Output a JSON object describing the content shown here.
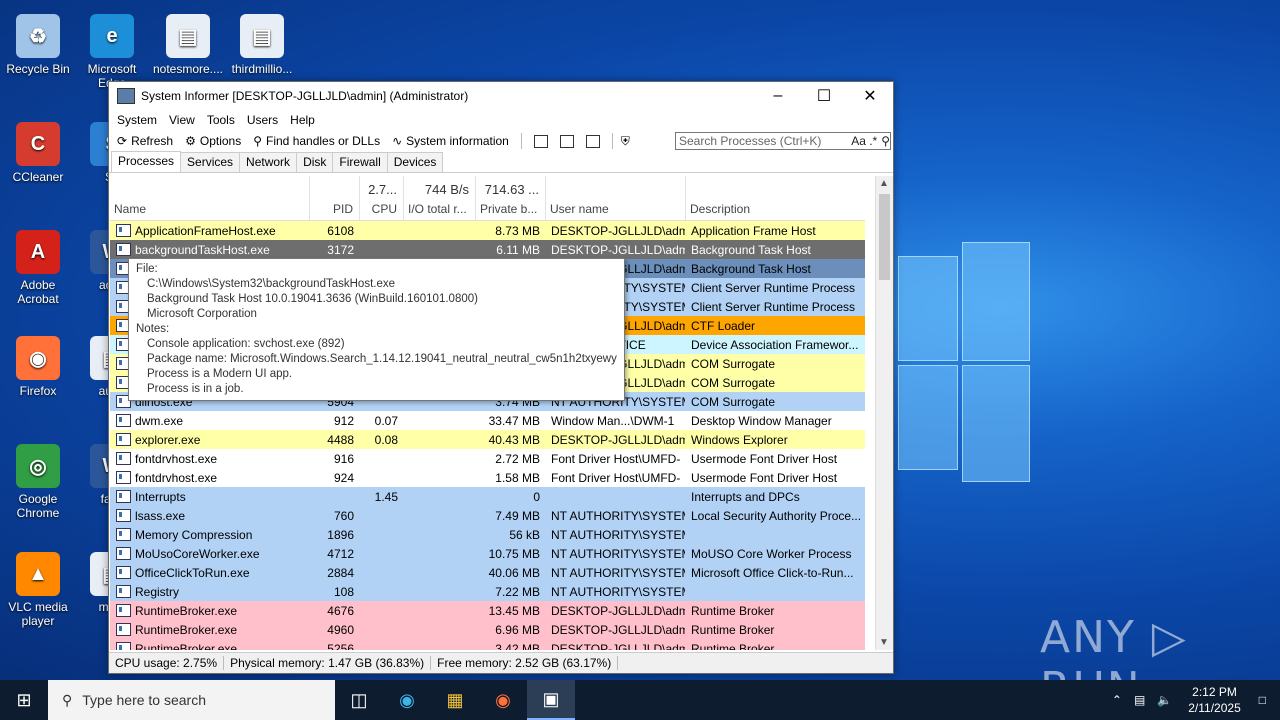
{
  "desktop": {
    "icons": [
      {
        "label": "Recycle Bin",
        "color": "#9fc4e8",
        "glyph": "♻"
      },
      {
        "label": "Microsoft Edge",
        "color": "#1d8fd8",
        "glyph": "e"
      },
      {
        "label": "notesmore....",
        "color": "#e8eef5",
        "glyph": "▤"
      },
      {
        "label": "thirdmillio...",
        "color": "#e8eef5",
        "glyph": "▤"
      },
      {
        "label": "CCleaner",
        "color": "#d63b2f",
        "glyph": "C"
      },
      {
        "label": "Sk",
        "color": "#2d7fd3",
        "glyph": "S"
      },
      {
        "label": "Adobe Acrobat",
        "color": "#d4221a",
        "glyph": "A"
      },
      {
        "label": "acad",
        "color": "#2b579a",
        "glyph": "W"
      },
      {
        "label": "Firefox",
        "color": "#ff7139",
        "glyph": "◉"
      },
      {
        "label": "augu",
        "color": "#e8eef5",
        "glyph": "▤"
      },
      {
        "label": "Google Chrome",
        "color": "#2f9e44",
        "glyph": "◎"
      },
      {
        "label": "fami",
        "color": "#2b579a",
        "glyph": "W"
      },
      {
        "label": "VLC media player",
        "color": "#ff8800",
        "glyph": "▲"
      },
      {
        "label": "moth",
        "color": "#e8eef5",
        "glyph": "▤"
      }
    ],
    "watermark": "ANY ▷ RUN"
  },
  "window": {
    "title": "System Informer [DESKTOP-JGLLJLD\\admin] (Administrator)",
    "menu": [
      "System",
      "View",
      "Tools",
      "Users",
      "Help"
    ],
    "toolbar": {
      "refresh": "Refresh",
      "options": "Options",
      "find": "Find handles or DLLs",
      "sysinfo": "System information"
    },
    "search_placeholder": "Search Processes (Ctrl+K)",
    "search_suffix": "Aa .*",
    "tabs": [
      "Processes",
      "Services",
      "Network",
      "Disk",
      "Firewall",
      "Devices"
    ],
    "header": {
      "name": "Name",
      "pid": "PID",
      "cpu": "CPU",
      "cpu_total": "2.7...",
      "io": "I/O total r...",
      "io_total": "744 B/s",
      "private": "Private b...",
      "private_total": "714.63 ...",
      "user": "User name",
      "desc": "Description"
    },
    "rows": [
      {
        "name": "ApplicationFrameHost.exe",
        "pid": "6108",
        "cpu": "",
        "io": "",
        "priv": "8.73 MB",
        "user": "DESKTOP-JGLLJLD\\admi",
        "desc": "Application Frame Host",
        "bg": "#ffffa8"
      },
      {
        "name": "backgroundTaskHost.exe",
        "pid": "3172",
        "cpu": "",
        "io": "",
        "priv": "6.11 MB",
        "user": "DESKTOP-JGLLJLD\\admi",
        "desc": "Background Task Host",
        "bg": "#6e6e6e"
      },
      {
        "name": "",
        "pid": "",
        "cpu": "",
        "io": "",
        "priv": "",
        "user": "DESKTOP-JGLLJLD\\admi",
        "desc": "Background Task Host",
        "bg": "#6b8fba"
      },
      {
        "name": "",
        "pid": "",
        "cpu": "",
        "io": "",
        "priv": "",
        "user": "NT AUTHORITY\\SYSTEM",
        "desc": "Client Server Runtime Process",
        "bg": "#b1d1f5"
      },
      {
        "name": "",
        "pid": "",
        "cpu": "",
        "io": "",
        "priv": "",
        "user": "NT AUTHORITY\\SYSTEM",
        "desc": "Client Server Runtime Process",
        "bg": "#b1d1f5"
      },
      {
        "name": "",
        "pid": "",
        "cpu": "",
        "io": "",
        "priv": "",
        "user": "DESKTOP-JGLLJLD\\admi",
        "desc": "CTF Loader",
        "bg": "#ffa500"
      },
      {
        "name": "",
        "pid": "",
        "cpu": "",
        "io": "",
        "priv": "",
        "user": "LOCAL SERVICE",
        "desc": "Device Association Framewor...",
        "bg": "#cdf5ff"
      },
      {
        "name": "",
        "pid": "",
        "cpu": "",
        "io": "",
        "priv": "",
        "user": "DESKTOP-JGLLJLD\\admi",
        "desc": "COM Surrogate",
        "bg": "#ffffa8"
      },
      {
        "name": "",
        "pid": "",
        "cpu": "",
        "io": "",
        "priv": "",
        "user": "DESKTOP-JGLLJLD\\admi",
        "desc": "COM Surrogate",
        "bg": "#ffffa8"
      },
      {
        "name": "dllhost.exe",
        "pid": "5904",
        "cpu": "",
        "io": "",
        "priv": "3.74 MB",
        "user": "NT AUTHORITY\\SYSTEM",
        "desc": "COM Surrogate",
        "bg": "#b1d1f5"
      },
      {
        "name": "dwm.exe",
        "pid": "912",
        "cpu": "0.07",
        "io": "",
        "priv": "33.47 MB",
        "user": "Window Man...\\DWM-1",
        "desc": "Desktop Window Manager",
        "bg": "#ffffff"
      },
      {
        "name": "explorer.exe",
        "pid": "4488",
        "cpu": "0.08",
        "io": "",
        "priv": "40.43 MB",
        "user": "DESKTOP-JGLLJLD\\admi",
        "desc": "Windows Explorer",
        "bg": "#ffffa8"
      },
      {
        "name": "fontdrvhost.exe",
        "pid": "916",
        "cpu": "",
        "io": "",
        "priv": "2.72 MB",
        "user": "Font Driver Host\\UMFD-",
        "desc": "Usermode Font Driver Host",
        "bg": "#ffffff"
      },
      {
        "name": "fontdrvhost.exe",
        "pid": "924",
        "cpu": "",
        "io": "",
        "priv": "1.58 MB",
        "user": "Font Driver Host\\UMFD-",
        "desc": "Usermode Font Driver Host",
        "bg": "#ffffff"
      },
      {
        "name": "Interrupts",
        "pid": "",
        "cpu": "1.45",
        "io": "",
        "priv": "0",
        "user": "",
        "desc": "Interrupts and DPCs",
        "bg": "#b1d1f5"
      },
      {
        "name": "lsass.exe",
        "pid": "760",
        "cpu": "",
        "io": "",
        "priv": "7.49 MB",
        "user": "NT AUTHORITY\\SYSTEM",
        "desc": "Local Security Authority Proce...",
        "bg": "#b1d1f5"
      },
      {
        "name": "Memory Compression",
        "pid": "1896",
        "cpu": "",
        "io": "",
        "priv": "56 kB",
        "user": "NT AUTHORITY\\SYSTEM",
        "desc": "",
        "bg": "#b1d1f5"
      },
      {
        "name": "MoUsoCoreWorker.exe",
        "pid": "4712",
        "cpu": "",
        "io": "",
        "priv": "10.75 MB",
        "user": "NT AUTHORITY\\SYSTEM",
        "desc": "MoUSO Core Worker Process",
        "bg": "#b1d1f5"
      },
      {
        "name": "OfficeClickToRun.exe",
        "pid": "2884",
        "cpu": "",
        "io": "",
        "priv": "40.06 MB",
        "user": "NT AUTHORITY\\SYSTEM",
        "desc": "Microsoft Office Click-to-Run...",
        "bg": "#b1d1f5"
      },
      {
        "name": "Registry",
        "pid": "108",
        "cpu": "",
        "io": "",
        "priv": "7.22 MB",
        "user": "NT AUTHORITY\\SYSTEM",
        "desc": "",
        "bg": "#b1d1f5"
      },
      {
        "name": "RuntimeBroker.exe",
        "pid": "4676",
        "cpu": "",
        "io": "",
        "priv": "13.45 MB",
        "user": "DESKTOP-JGLLJLD\\admi",
        "desc": "Runtime Broker",
        "bg": "#ffc0cb"
      },
      {
        "name": "RuntimeBroker.exe",
        "pid": "4960",
        "cpu": "",
        "io": "",
        "priv": "6.96 MB",
        "user": "DESKTOP-JGLLJLD\\admi",
        "desc": "Runtime Broker",
        "bg": "#ffc0cb"
      },
      {
        "name": "RuntimeBroker.exe",
        "pid": "5256",
        "cpu": "",
        "io": "",
        "priv": "3.42 MB",
        "user": "DESKTOP-JGLLJLD\\admi",
        "desc": "Runtime Broker",
        "bg": "#ffc0cb"
      }
    ],
    "status": {
      "cpu": "CPU usage: 2.75%",
      "phys": "Physical memory: 1.47 GB (36.83%)",
      "free": "Free memory: 2.52 GB (63.17%)"
    }
  },
  "tooltip": {
    "file_label": "File:",
    "path": "C:\\Windows\\System32\\backgroundTaskHost.exe",
    "version": "Background Task Host 10.0.19041.3636 (WinBuild.160101.0800)",
    "company": "Microsoft Corporation",
    "notes_label": "Notes:",
    "console": "Console application: svchost.exe (892)",
    "package": "Package name: Microsoft.Windows.Search_1.14.12.19041_neutral_neutral_cw5n1h2txyewy",
    "modern": "Process is a Modern UI app.",
    "job": "Process is in a job."
  },
  "taskbar": {
    "search_placeholder": "Type here to search",
    "time": "2:12 PM",
    "date": "2/11/2025"
  }
}
